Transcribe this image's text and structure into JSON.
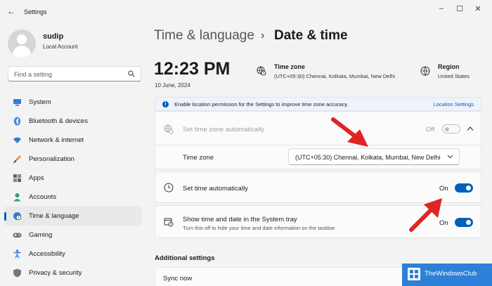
{
  "window": {
    "title": "Settings",
    "back_icon": "arrow-left-icon",
    "controls": [
      "minimize-icon",
      "maximize-icon",
      "close-icon"
    ]
  },
  "user": {
    "name": "sudip",
    "account_type": "Local Account"
  },
  "search": {
    "placeholder": "Find a setting"
  },
  "nav": {
    "items": [
      {
        "label": "System",
        "icon": "system-icon",
        "active": false
      },
      {
        "label": "Bluetooth & devices",
        "icon": "bluetooth-icon",
        "active": false
      },
      {
        "label": "Network & internet",
        "icon": "wifi-icon",
        "active": false
      },
      {
        "label": "Personalization",
        "icon": "brush-icon",
        "active": false
      },
      {
        "label": "Apps",
        "icon": "apps-icon",
        "active": false
      },
      {
        "label": "Accounts",
        "icon": "person-icon",
        "active": false
      },
      {
        "label": "Time & language",
        "icon": "clock-globe-icon",
        "active": true
      },
      {
        "label": "Gaming",
        "icon": "gamepad-icon",
        "active": false
      },
      {
        "label": "Accessibility",
        "icon": "accessibility-icon",
        "active": false
      },
      {
        "label": "Privacy & security",
        "icon": "shield-icon",
        "active": false
      }
    ]
  },
  "breadcrumb": {
    "parent": "Time & language",
    "separator": "›",
    "current": "Date & time"
  },
  "clock": {
    "time": "12:23 PM",
    "date": "10 June, 2024"
  },
  "summary": {
    "time_zone": {
      "title": "Time zone",
      "value": "(UTC+05:30) Chennai, Kolkata, Mumbai, New Delhi"
    },
    "region": {
      "title": "Region",
      "value": "United States"
    }
  },
  "info_bar": {
    "text": "Enable location permission for the Settings to improve time zone accuracy.",
    "link": "Location Settings",
    "icon_glyph": "i"
  },
  "settings": {
    "auto_timezone": {
      "label": "Set time zone automatically",
      "state": "Off",
      "enabled": false
    },
    "timezone": {
      "label": "Time zone",
      "value": "(UTC+05:30) Chennai, Kolkata, Mumbai, New Delhi"
    },
    "auto_time": {
      "label": "Set time automatically",
      "state": "On"
    },
    "system_tray": {
      "label": "Show time and date in the System tray",
      "description": "Turn this off to hide your time and date information on the taskbar",
      "state": "On"
    }
  },
  "additional": {
    "title": "Additional settings",
    "sync_label": "Sync now"
  },
  "watermark": {
    "text": "TheWindowsClub"
  },
  "colors": {
    "accent": "#005fb8",
    "annotation_arrow": "#e02424",
    "watermark": "#2d80d7"
  }
}
